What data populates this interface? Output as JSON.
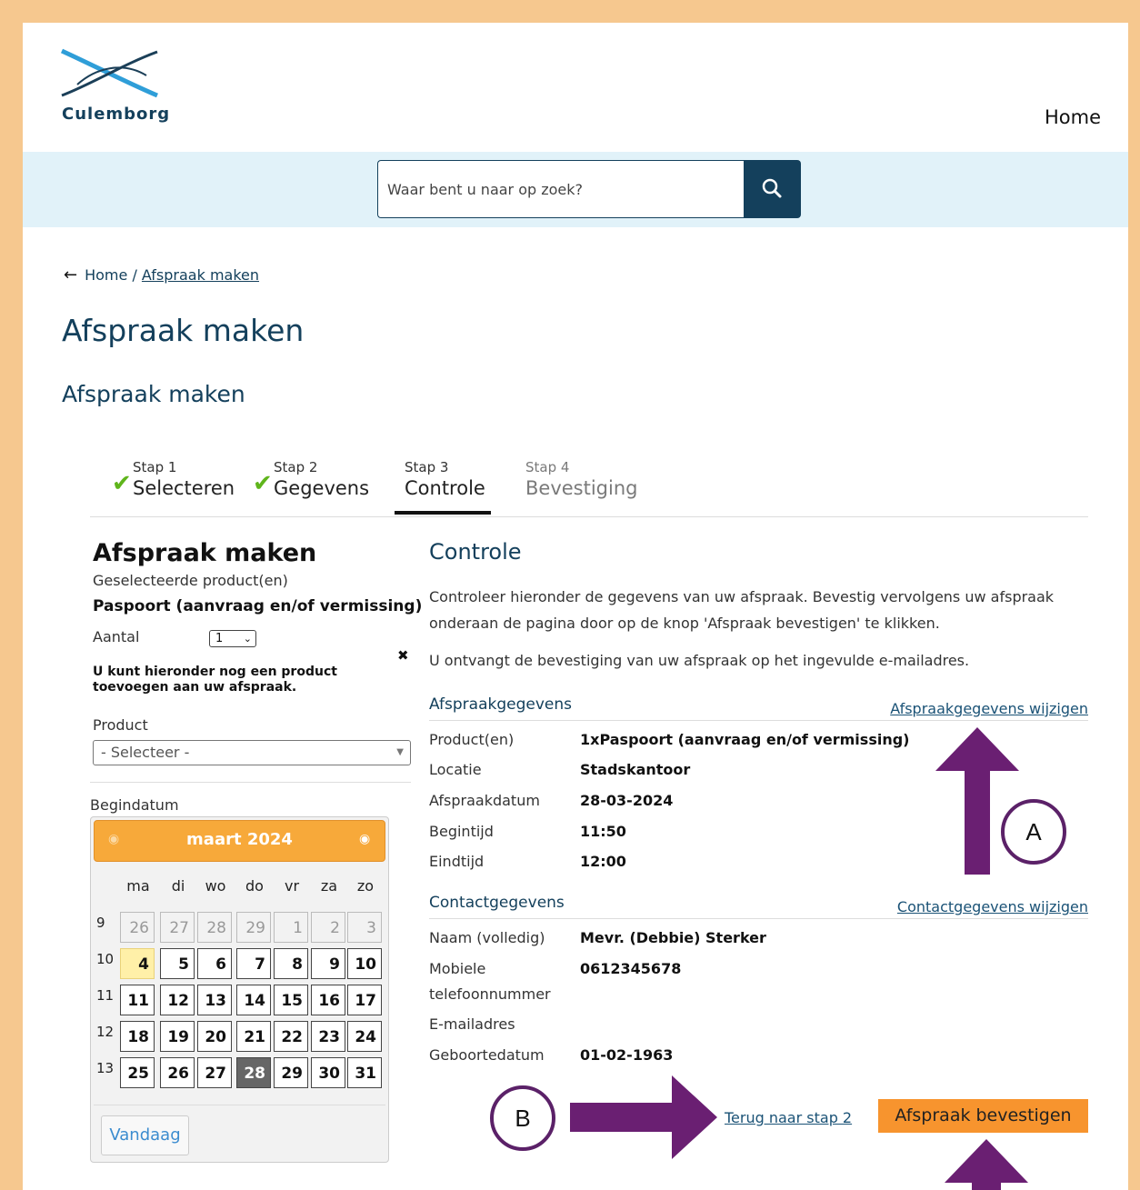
{
  "header": {
    "logo_text": "Culemborg",
    "nav_home": "Home"
  },
  "search": {
    "placeholder": "Waar bent u naar op zoek?"
  },
  "breadcrumb": {
    "home": "Home",
    "separator": "/",
    "current": "Afspraak maken"
  },
  "page_title": "Afspraak maken",
  "section_title": "Afspraak maken",
  "steps": [
    {
      "label": "Stap 1",
      "name": "Selecteren",
      "status": "done"
    },
    {
      "label": "Stap 2",
      "name": "Gegevens",
      "status": "done"
    },
    {
      "label": "Stap 3",
      "name": "Controle",
      "status": "active"
    },
    {
      "label": "Stap 4",
      "name": "Bevestiging",
      "status": "future"
    }
  ],
  "left": {
    "title": "Afspraak maken",
    "selected_label": "Geselecteerde product(en)",
    "selected_product": "Paspoort (aanvraag en/of vermissing)",
    "aantal_label": "Aantal",
    "aantal_value": "1",
    "hint": "U kunt hieronder nog een product toevoegen aan uw afspraak.",
    "product_label": "Product",
    "product_select": "- Selecteer -",
    "begindatum_label": "Begindatum"
  },
  "calendar": {
    "month": "maart 2024",
    "weekdays": [
      "ma",
      "di",
      "wo",
      "do",
      "vr",
      "za",
      "zo"
    ],
    "weeks": [
      {
        "wk": "9",
        "days": [
          "26",
          "27",
          "28",
          "29",
          "1",
          "2",
          "3"
        ]
      },
      {
        "wk": "10",
        "days": [
          "4",
          "5",
          "6",
          "7",
          "8",
          "9",
          "10"
        ]
      },
      {
        "wk": "11",
        "days": [
          "11",
          "12",
          "13",
          "14",
          "15",
          "16",
          "17"
        ]
      },
      {
        "wk": "12",
        "days": [
          "18",
          "19",
          "20",
          "21",
          "22",
          "23",
          "24"
        ]
      },
      {
        "wk": "13",
        "days": [
          "25",
          "26",
          "27",
          "28",
          "29",
          "30",
          "31"
        ]
      }
    ],
    "today_day": "4",
    "selected_day": "28",
    "today_button": "Vandaag"
  },
  "controle": {
    "title": "Controle",
    "intro": "Controleer hieronder de gegevens van uw afspraak. Bevestig vervolgens uw afspraak onderaan de pagina door op de knop 'Afspraak bevestigen' te klikken.",
    "email_note": "U ontvangt de bevestiging van uw afspraak op het ingevulde e-mailadres.",
    "afspraak": {
      "heading": "Afspraakgegevens",
      "edit_link": "Afspraakgegevens wijzigen",
      "rows": [
        {
          "key": "Product(en)",
          "value": "1xPaspoort (aanvraag en/of vermissing)"
        },
        {
          "key": "Locatie",
          "value": "Stadskantoor"
        },
        {
          "key": "Afspraakdatum",
          "value": "28-03-2024"
        },
        {
          "key": "Begintijd",
          "value": "11:50"
        },
        {
          "key": "Eindtijd",
          "value": "12:00"
        }
      ]
    },
    "contact": {
      "heading": "Contactgegevens",
      "edit_link": "Contactgegevens wijzigen",
      "rows": [
        {
          "key": "Naam (volledig)",
          "value": "Mevr. (Debbie) Sterker"
        },
        {
          "key": "Mobiele telefoonnummer",
          "value": "0612345678"
        },
        {
          "key": "E-mailadres",
          "value": ""
        },
        {
          "key": "Geboortedatum",
          "value": "01-02-1963"
        }
      ]
    },
    "back_link": "Terug naar stap 2",
    "confirm_button": "Afspraak bevestigen"
  },
  "annotations": {
    "a": "A",
    "b": "B",
    "arrow_color": "#6a1f72"
  }
}
